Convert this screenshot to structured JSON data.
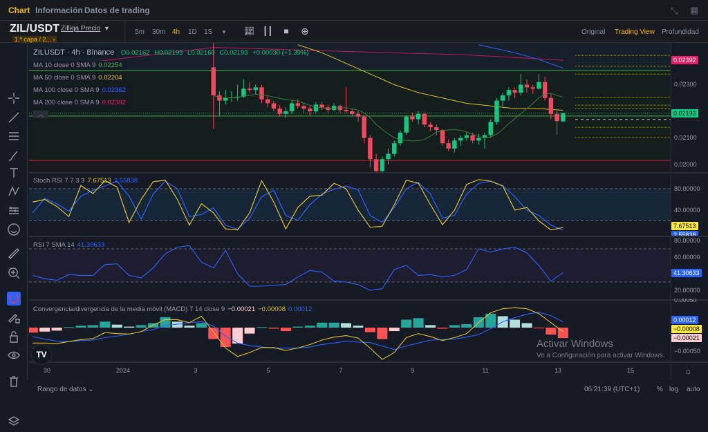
{
  "tabs": [
    {
      "label": "Chart",
      "active": true
    },
    {
      "label": "Información"
    },
    {
      "label": "Datos de trading"
    }
  ],
  "symbol": {
    "pair": "ZIL/USDT",
    "name": "Zilliqa Precio",
    "badge": "1.ª capa / 2... ›"
  },
  "timeframes": [
    {
      "label": "5m"
    },
    {
      "label": "30m"
    },
    {
      "label": "4h",
      "active": true
    },
    {
      "label": "1D"
    },
    {
      "label": "1S"
    }
  ],
  "toolbar_icons": [
    "indicators-icon",
    "candle-type-icon",
    "camera-icon",
    "add-icon"
  ],
  "views": [
    {
      "label": "Original"
    },
    {
      "label": "Trading View",
      "active": true
    },
    {
      "label": "Profundidad"
    }
  ],
  "left_tools": [
    "crosshair-icon",
    "trend-line-icon",
    "fib-lines-icon",
    "brush-icon",
    "text-icon",
    "pattern-icon",
    "forecast-icon",
    "emoji-icon",
    "ruler-icon",
    "zoom-in-icon",
    "magnet-icon",
    "lock-drawing-icon",
    "lock-icon",
    "eye-icon",
    "trash-icon",
    "layers-icon"
  ],
  "colors": {
    "up": "#0ecb81",
    "down": "#f6465d",
    "ma10": "#4caf50",
    "ma50": "#e0c32c",
    "ma100": "#2962ff",
    "ma200": "#c2185b",
    "stoch_k": "#e0c32c",
    "stoch_d": "#2962ff",
    "rsi": "#2962ff",
    "hist_up": "#26a69a",
    "hist_up_fade": "#b2dfdb",
    "hist_dn": "#ff5252",
    "hist_dn_fade": "#ffcdd2"
  },
  "legend": {
    "title": "ZILUSDT · 4h · Binance",
    "ohlc": {
      "o": "O0.02162",
      "h": "H0.02193",
      "l": "L0.02160",
      "c": "C0.02193",
      "chg": "+0.00030 (+1.39%)"
    },
    "ma": [
      {
        "label": "MA 10 close 0 SMA 9",
        "value": "0.02254",
        "color": "#4caf50"
      },
      {
        "label": "MA 50 close 0 SMA 9",
        "value": "0.02204",
        "color": "#e0c32c"
      },
      {
        "label": "MA 100 close 0 SMA 9",
        "value": "0.02362",
        "color": "#2962ff"
      },
      {
        "label": "MA 200 close 0 SMA 9",
        "value": "0.02392",
        "color": "#e91e63"
      }
    ],
    "stoch": {
      "label": "Stoch RSI 7 7 3 3",
      "k": "7.67513",
      "d": "2.55838"
    },
    "rsi": {
      "label": "RSI 7 SMA 14",
      "value": "41.30633"
    },
    "macd": {
      "label": "Convergencia/divergencia de la media móvil (MACD) 7 14 close 9",
      "hist": "−0.00021",
      "macd": "−0.00008",
      "signal": "0.00012"
    }
  },
  "price_axis": {
    "ticks": [
      "0.02300",
      "0.02100",
      "0.02000"
    ],
    "tick_values": [
      0.023,
      0.021,
      0.02
    ],
    "last_ma200": "0.02392",
    "last_price": "0.02193"
  },
  "stoch_axis": {
    "ticks": [
      "80.00000",
      "40.00000"
    ],
    "tag_k": "7.67513",
    "tag_d": "2.55838"
  },
  "rsi_axis": {
    "ticks": [
      "80.00000",
      "60.00000",
      "20.00000"
    ],
    "tag": "41.30633"
  },
  "macd_axis": {
    "ticks": [
      "0.00050",
      "−0.00050"
    ],
    "tag_signal": "0.00012",
    "tag_macd": "−0.00008",
    "tag_hist": "−0.00021"
  },
  "x_axis": {
    "labels": [
      "30",
      "2024",
      "3",
      "5",
      "7",
      "9",
      "11",
      "13",
      "15"
    ]
  },
  "status": {
    "range": "Rango de datos ⌄",
    "time": "06:21:39 (UTC+1)",
    "pct": "%",
    "log": "log",
    "auto": "auto"
  },
  "watermark": {
    "line1": "Activar Windows",
    "line2": "Ve a Configuración para activar Windows."
  },
  "chart_data": {
    "type": "candlestick",
    "interval": "4h",
    "candles_start": "2024-01-03 12:00",
    "candles": [
      [
        0.02365,
        0.0246,
        0.02135,
        0.0226
      ],
      [
        0.0226,
        0.02275,
        0.0218,
        0.0224
      ],
      [
        0.0224,
        0.0228,
        0.02225,
        0.0225
      ],
      [
        0.0225,
        0.02275,
        0.02235,
        0.02252
      ],
      [
        0.02252,
        0.023,
        0.0224,
        0.02255
      ],
      [
        0.02255,
        0.0232,
        0.0225,
        0.02285
      ],
      [
        0.02285,
        0.0231,
        0.0227,
        0.0228
      ],
      [
        0.0228,
        0.023,
        0.02265,
        0.0229
      ],
      [
        0.0229,
        0.023,
        0.0223,
        0.02245
      ],
      [
        0.02245,
        0.0226,
        0.02215,
        0.0223
      ],
      [
        0.0223,
        0.0224,
        0.022,
        0.0221
      ],
      [
        0.0221,
        0.02225,
        0.0218,
        0.0219
      ],
      [
        0.0219,
        0.02215,
        0.02175,
        0.022
      ],
      [
        0.022,
        0.0224,
        0.0219,
        0.0223
      ],
      [
        0.0223,
        0.02245,
        0.0221,
        0.0222
      ],
      [
        0.0222,
        0.0223,
        0.02195,
        0.0221
      ],
      [
        0.0221,
        0.0222,
        0.02185,
        0.022
      ],
      [
        0.022,
        0.02235,
        0.02195,
        0.02225
      ],
      [
        0.02225,
        0.02235,
        0.02205,
        0.02215
      ],
      [
        0.02215,
        0.02225,
        0.02195,
        0.02205
      ],
      [
        0.02205,
        0.0223,
        0.022,
        0.0222
      ],
      [
        0.0222,
        0.02225,
        0.02195,
        0.02205
      ],
      [
        0.02205,
        0.0229,
        0.02195,
        0.022
      ],
      [
        0.022,
        0.0221,
        0.0218,
        0.0219
      ],
      [
        0.0219,
        0.022,
        0.0216,
        0.0218
      ],
      [
        0.0218,
        0.02185,
        0.0208,
        0.021
      ],
      [
        0.021,
        0.0211,
        0.0199,
        0.0202
      ],
      [
        0.0202,
        0.0204,
        0.0196,
        0.01975
      ],
      [
        0.01975,
        0.0203,
        0.0196,
        0.0202
      ],
      [
        0.0202,
        0.0206,
        0.02,
        0.0204
      ],
      [
        0.0204,
        0.0209,
        0.0203,
        0.0208
      ],
      [
        0.0208,
        0.0213,
        0.0207,
        0.0212
      ],
      [
        0.0212,
        0.02185,
        0.0211,
        0.0218
      ],
      [
        0.0218,
        0.02195,
        0.0216,
        0.0217
      ],
      [
        0.0217,
        0.022,
        0.0215,
        0.0219
      ],
      [
        0.0219,
        0.02195,
        0.0214,
        0.0215
      ],
      [
        0.0215,
        0.0216,
        0.02125,
        0.0214
      ],
      [
        0.0214,
        0.0215,
        0.0211,
        0.0213
      ],
      [
        0.0213,
        0.02135,
        0.0207,
        0.0208
      ],
      [
        0.0208,
        0.02095,
        0.0205,
        0.0206
      ],
      [
        0.0206,
        0.021,
        0.02045,
        0.0209
      ],
      [
        0.0209,
        0.0211,
        0.0207,
        0.021
      ],
      [
        0.021,
        0.0212,
        0.0209,
        0.0211
      ],
      [
        0.0211,
        0.0212,
        0.0208,
        0.0209
      ],
      [
        0.0209,
        0.02115,
        0.02075,
        0.021
      ],
      [
        0.021,
        0.0212,
        0.0206,
        0.0211
      ],
      [
        0.0211,
        0.0217,
        0.021,
        0.0216
      ],
      [
        0.0216,
        0.0225,
        0.0215,
        0.0224
      ],
      [
        0.0224,
        0.0227,
        0.0222,
        0.0226
      ],
      [
        0.0226,
        0.0229,
        0.0224,
        0.0228
      ],
      [
        0.0228,
        0.0229,
        0.0225,
        0.0227
      ],
      [
        0.0227,
        0.0234,
        0.0226,
        0.023
      ],
      [
        0.023,
        0.0232,
        0.0227,
        0.0229
      ],
      [
        0.0229,
        0.023,
        0.02265,
        0.02285
      ],
      [
        0.02285,
        0.0234,
        0.0228,
        0.0231
      ],
      [
        0.0231,
        0.0233,
        0.0224,
        0.0225
      ],
      [
        0.0225,
        0.02265,
        0.0217,
        0.0219
      ],
      [
        0.0219,
        0.022,
        0.0211,
        0.02163
      ],
      [
        0.02162,
        0.02193,
        0.0216,
        0.02193
      ]
    ],
    "price_range": [
      0.01975,
      0.02465
    ],
    "ma50": [
      [
        "2024-01-05 20:00",
        0.0245
      ],
      [
        "2024-01-06 12:00",
        0.0242
      ],
      [
        "2024-01-07 04:00",
        0.0238
      ],
      [
        "2024-01-07 20:00",
        0.0234
      ],
      [
        "2024-01-08 12:00",
        0.023
      ],
      [
        "2024-01-09 04:00",
        0.0227
      ],
      [
        "2024-01-09 20:00",
        0.0225
      ],
      [
        "2024-01-10 12:00",
        0.0223
      ],
      [
        "2024-01-11 04:00",
        0.0222
      ],
      [
        "2024-01-11 20:00",
        0.0221
      ],
      [
        "2024-01-12 12:00",
        0.0221
      ],
      [
        "2024-01-13 04:00",
        0.02204
      ]
    ],
    "ma100": [
      [
        "2024-01-10 20:00",
        0.0245
      ],
      [
        "2024-01-11 20:00",
        0.0242
      ],
      [
        "2024-01-12 12:00",
        0.02395
      ],
      [
        "2024-01-13 04:00",
        0.02362
      ]
    ],
    "ma200": [
      [
        "2023-12-29 12:00",
        0.02358
      ],
      [
        "2024-01-03 12:00",
        0.0244
      ],
      [
        "2024-01-07 04:00",
        0.02425
      ],
      [
        "2024-01-10 12:00",
        0.02412
      ],
      [
        "2024-01-13 04:00",
        0.02392
      ]
    ],
    "horizontal_lines": [
      {
        "value": 0.02353,
        "color": "#4caf50"
      },
      {
        "value": 0.02182,
        "color": "#4caf50"
      },
      {
        "value": 0.02015,
        "color": "#b22833"
      }
    ],
    "order_levels": [
      0.0241,
      0.02369,
      0.0234,
      0.02252,
      0.02223,
      0.0221,
      0.0214,
      0.02101
    ],
    "last_price": 0.02193,
    "indicators_start": "2023-12-29 12:00",
    "indicators_interval": "8h",
    "stoch_k": [
      55,
      60,
      47,
      28,
      86,
      71,
      95,
      83,
      17,
      60,
      93,
      96,
      60,
      12,
      52,
      35,
      5,
      3,
      35,
      95,
      55,
      5,
      45,
      66,
      68,
      90,
      80,
      40,
      8,
      10,
      50,
      96,
      90,
      50,
      13,
      40,
      88,
      97,
      94,
      85,
      40,
      45,
      20,
      3,
      7.67513
    ],
    "stoch_d": [
      35,
      62,
      52,
      38,
      66,
      77,
      85,
      94,
      66,
      23,
      70,
      94,
      80,
      28,
      32,
      44,
      12,
      4,
      25,
      65,
      77,
      30,
      21,
      50,
      70,
      79,
      85,
      78,
      30,
      17,
      45,
      80,
      92,
      70,
      25,
      30,
      70,
      90,
      94,
      86,
      65,
      40,
      30,
      12,
      2.55838
    ],
    "stoch_bands": [
      80,
      20
    ],
    "rsi": [
      38,
      34,
      32,
      39,
      38,
      38,
      51,
      52,
      38,
      35,
      47,
      64,
      72,
      74,
      54,
      47,
      68,
      40,
      25,
      25,
      26,
      27,
      36,
      44,
      42,
      31,
      30,
      27,
      20,
      22,
      45,
      50,
      38,
      39,
      36,
      38,
      45,
      70,
      66,
      70,
      72,
      65,
      50,
      31,
      41.30633
    ],
    "rsi_bands": [
      70,
      30
    ],
    "macd_hist": [
      -0.0001,
      -8e-05,
      -6e-05,
      1e-05,
      4e-05,
      5e-05,
      0.00012,
      6e-05,
      2e-05,
      5e-05,
      9e-05,
      0.00021,
      0.00012,
      4e-05,
      9e-05,
      -0.00023,
      -0.00039,
      -0.00032,
      -0.00012,
      1e-05,
      -2e-05,
      -7e-05,
      2e-05,
      4e-05,
      0.0001,
      0.0001,
      9e-05,
      4e-05,
      -9e-05,
      -0.00023,
      -7e-05,
      0.00016,
      0.00019,
      5e-05,
      -2e-05,
      5e-05,
      7e-05,
      0.00021,
      0.00028,
      0.00023,
      0.00016,
      9e-05,
      -1e-05,
      -0.00014,
      -0.00021
    ],
    "macd_line": [
      -0.00031,
      -0.00031,
      -0.00032,
      -0.00028,
      -0.00024,
      -0.00022,
      -0.0001,
      -0.00012,
      -0.00013,
      -8e-05,
      5e-05,
      0.00016,
      0.00016,
      0.0001,
      0.00023,
      -9e-05,
      -0.00041,
      -0.00058,
      -0.0005,
      -0.0004,
      -0.0004,
      -0.00046,
      -0.00041,
      -0.00034,
      -0.00025,
      -0.00019,
      -0.00016,
      -0.00021,
      -0.00041,
      -0.00064,
      -0.0005,
      -0.0002,
      -0.00012,
      -0.00018,
      -0.00026,
      -0.0002,
      -0.00012,
      0.0001,
      0.0003,
      0.00038,
      0.0004,
      0.00038,
      0.00028,
      0.0001,
      -8e-05
    ],
    "macd_signal": [
      -0.00018,
      -0.00023,
      -0.00027,
      -0.00028,
      -0.00026,
      -0.00025,
      -0.0002,
      -0.00017,
      -0.00013,
      -8e-05,
      -4e-05,
      4e-05,
      7e-05,
      0.0001,
      0.00012,
      3e-05,
      -0.00017,
      -0.00031,
      -0.00036,
      -0.00039,
      -0.00041,
      -0.00041,
      -0.00041,
      -0.00039,
      -0.00034,
      -0.00031,
      -0.00027,
      -0.00029,
      -0.0003,
      -0.00037,
      -0.00044,
      -0.00037,
      -0.00031,
      -0.00025,
      -0.00024,
      -0.00023,
      -0.00019,
      -0.00014,
      -2e-05,
      0.00012,
      0.0002,
      0.00027,
      0.00031,
      0.00024,
      0.00012
    ]
  }
}
